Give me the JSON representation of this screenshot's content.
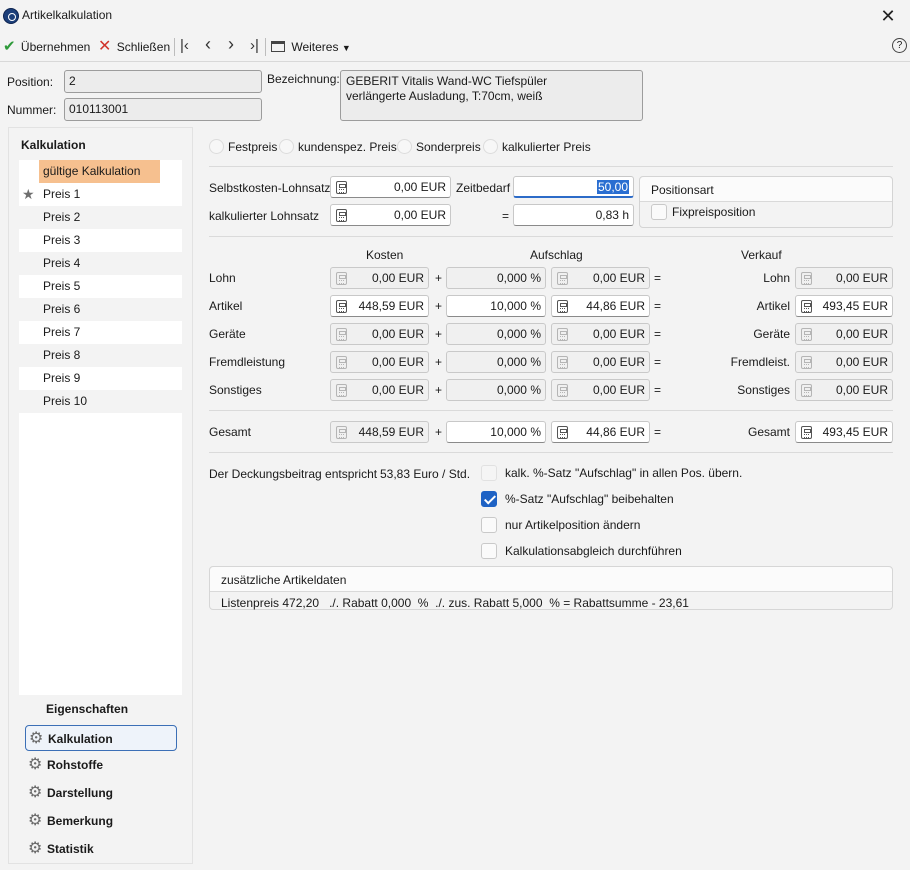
{
  "window": {
    "title": "Artikelkalkulation",
    "close_glyph": "✕"
  },
  "toolbar": {
    "apply_label": "Übernehmen",
    "close_label": "Schließen",
    "more_label": "Weiteres",
    "help_glyph": "?",
    "nav_icons": [
      "first-icon",
      "prev-icon",
      "next-icon",
      "last-icon"
    ]
  },
  "header": {
    "position_label": "Position:",
    "position_value": "2",
    "nummer_label": "Nummer:",
    "nummer_value": "010113001",
    "bezeichnung_label": "Bezeichnung:",
    "bezeichnung_line1": "GEBERIT Vitalis Wand-WC Tiefspüler",
    "bezeichnung_line2": "verlängerte Ausladung, T:70cm, weiß"
  },
  "sidebar": {
    "kalk_title": "Kalkulation",
    "active_item": "gültige Kalkulation",
    "items": [
      "Preis 1",
      "Preis 2",
      "Preis 3",
      "Preis 4",
      "Preis 5",
      "Preis 6",
      "Preis 7",
      "Preis 8",
      "Preis 9",
      "Preis 10"
    ],
    "eig_title": "Eigenschaften",
    "nav": [
      "Kalkulation",
      "Rohstoffe",
      "Darstellung",
      "Bemerkung",
      "Statistik"
    ]
  },
  "pricing_mode": {
    "options": [
      "Festpreis",
      "kundenspez. Preis",
      "Sonderpreis",
      "kalkulierter Preis"
    ]
  },
  "lohn": {
    "selbst_label": "Selbstkosten-Lohnsatz",
    "selbst_value": "0,00 EUR",
    "kalk_label": "kalkulierter Lohnsatz",
    "kalk_value": "0,00 EUR",
    "zeit_label": "Zeitbedarf",
    "zeit_value": "50,00",
    "eq": "=",
    "zeit_result": "0,83 h"
  },
  "positionsart": {
    "title": "Positionsart",
    "fix_label": "Fixpreisposition"
  },
  "grid": {
    "h_kosten": "Kosten",
    "h_aufschlag": "Aufschlag",
    "h_verkauf": "Verkauf",
    "plus": "+",
    "eq": "=",
    "rows": [
      {
        "label": "Lohn",
        "kosten": "0,00 EUR",
        "pct": "0,000 %",
        "auf": "0,00 EUR",
        "vlabel": "Lohn",
        "verkauf": "0,00 EUR"
      },
      {
        "label": "Artikel",
        "kosten": "448,59 EUR",
        "pct": "10,000 %",
        "auf": "44,86 EUR",
        "vlabel": "Artikel",
        "verkauf": "493,45 EUR"
      },
      {
        "label": "Geräte",
        "kosten": "0,00 EUR",
        "pct": "0,000 %",
        "auf": "0,00 EUR",
        "vlabel": "Geräte",
        "verkauf": "0,00 EUR"
      },
      {
        "label": "Fremdleistung",
        "kosten": "0,00 EUR",
        "pct": "0,000 %",
        "auf": "0,00 EUR",
        "vlabel": "Fremdleist.",
        "verkauf": "0,00 EUR"
      },
      {
        "label": "Sonstiges",
        "kosten": "0,00 EUR",
        "pct": "0,000 %",
        "auf": "0,00 EUR",
        "vlabel": "Sonstiges",
        "verkauf": "0,00 EUR"
      }
    ],
    "total": {
      "label": "Gesamt",
      "kosten": "448,59 EUR",
      "pct": "10,000 %",
      "auf": "44,86 EUR",
      "vlabel": "Gesamt",
      "verkauf": "493,45 EUR"
    }
  },
  "deckung": {
    "label": "Der Deckungsbeitrag entspricht",
    "value": "53,83 Euro / Std."
  },
  "options": [
    {
      "label": "kalk. %-Satz \"Aufschlag\" in allen Pos. übern.",
      "checked": false,
      "disabled": true
    },
    {
      "label": "%-Satz \"Aufschlag\" beibehalten",
      "checked": true,
      "disabled": false
    },
    {
      "label": "nur Artikelposition ändern",
      "checked": false,
      "disabled": false
    },
    {
      "label": "Kalkulationsabgleich durchführen",
      "checked": false,
      "disabled": false
    }
  ],
  "zusatz": {
    "title": "zusätzliche Artikeldaten",
    "text": "Listenpreis 472,20   ./. Rabatt 0,000  %  ./. zus. Rabatt 5,000  % = Rabattsumme - 23,61"
  }
}
